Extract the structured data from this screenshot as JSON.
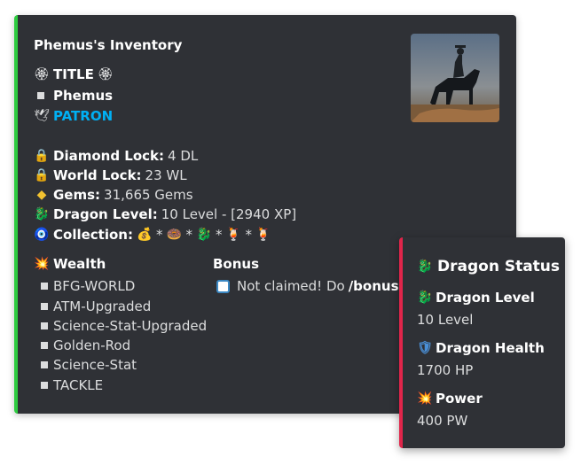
{
  "inventory": {
    "title": "Phemus's Inventory",
    "rank_title": "TITLE",
    "player_name": "Phemus",
    "patron": "PATRON",
    "accent_color": "#2ecc40",
    "stats": [
      {
        "label": "Diamond Lock:",
        "value": "4 DL",
        "icon": "diamond-lock-icon"
      },
      {
        "label": "World Lock:",
        "value": "23 WL",
        "icon": "world-lock-icon"
      },
      {
        "label": "Gems:",
        "value": "31,665 Gems",
        "icon": "gem-icon"
      },
      {
        "label": "Dragon Level:",
        "value": "10 Level - [2940 XP]",
        "icon": "dragon-icon"
      },
      {
        "label": "Collection:",
        "value": "",
        "icon": "collection-icon"
      }
    ],
    "collection_separator": "*",
    "wealth": {
      "title": "Wealth",
      "items": [
        "BFG-WORLD",
        "ATM-Upgraded",
        "Science-Stat-Upgraded",
        "Golden-Rod",
        "Science-Stat",
        "TACKLE"
      ]
    },
    "bonus": {
      "title": "Bonus",
      "text": "Not claimed! Do",
      "command": "/bonus"
    }
  },
  "dragon_status": {
    "title": "Dragon Status",
    "accent_color": "#e0254a",
    "fields": [
      {
        "name": "Dragon Level",
        "value": "10 Level",
        "icon": "dragon-icon"
      },
      {
        "name": "Dragon Health",
        "value": "1700 HP",
        "icon": "shield-icon"
      },
      {
        "name": "Power",
        "value": "400 PW",
        "icon": "explosion-icon"
      }
    ]
  }
}
